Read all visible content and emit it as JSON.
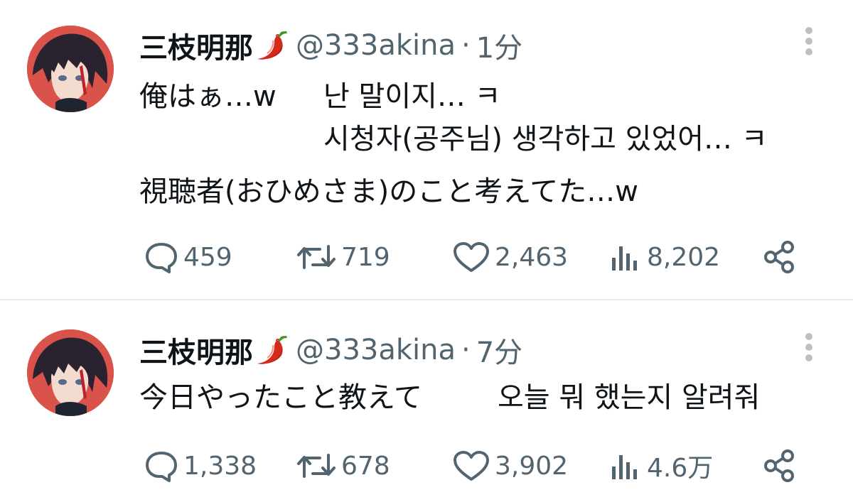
{
  "tweets": [
    {
      "author_name": "三枝明那",
      "handle": "@333akina",
      "separator": "·",
      "time": "1分",
      "text_lines": [
        "俺はぁ…w",
        "난 말이지… ㅋ",
        "시청자(공주님) 생각하고 있었어… ㅋ",
        "視聴者(おひめさま)のこと考えてた…w"
      ],
      "stats": {
        "replies": "459",
        "retweets": "719",
        "likes": "2,463",
        "views": "8,202"
      }
    },
    {
      "author_name": "三枝明那",
      "handle": "@333akina",
      "separator": "·",
      "time": "7分",
      "text_lines": [
        "今日やったこと教えて",
        "오늘 뭐 했는지 알려줘"
      ],
      "stats": {
        "replies": "1,338",
        "retweets": "678",
        "likes": "3,902",
        "views": "4.6万"
      }
    }
  ],
  "icons": {
    "reply": "speech-bubble-icon",
    "retweet": "retweet-icon",
    "like": "heart-icon",
    "views": "bar-chart-icon",
    "share": "share-icon",
    "more": "more-vertical-icon",
    "emoji": "chili-pepper-icon"
  },
  "colors": {
    "text_primary": "#0f1419",
    "text_secondary": "#536471",
    "avatar_bg": "#d9534a",
    "chili_red": "#d42a1c",
    "divider": "#e6e9ec"
  }
}
